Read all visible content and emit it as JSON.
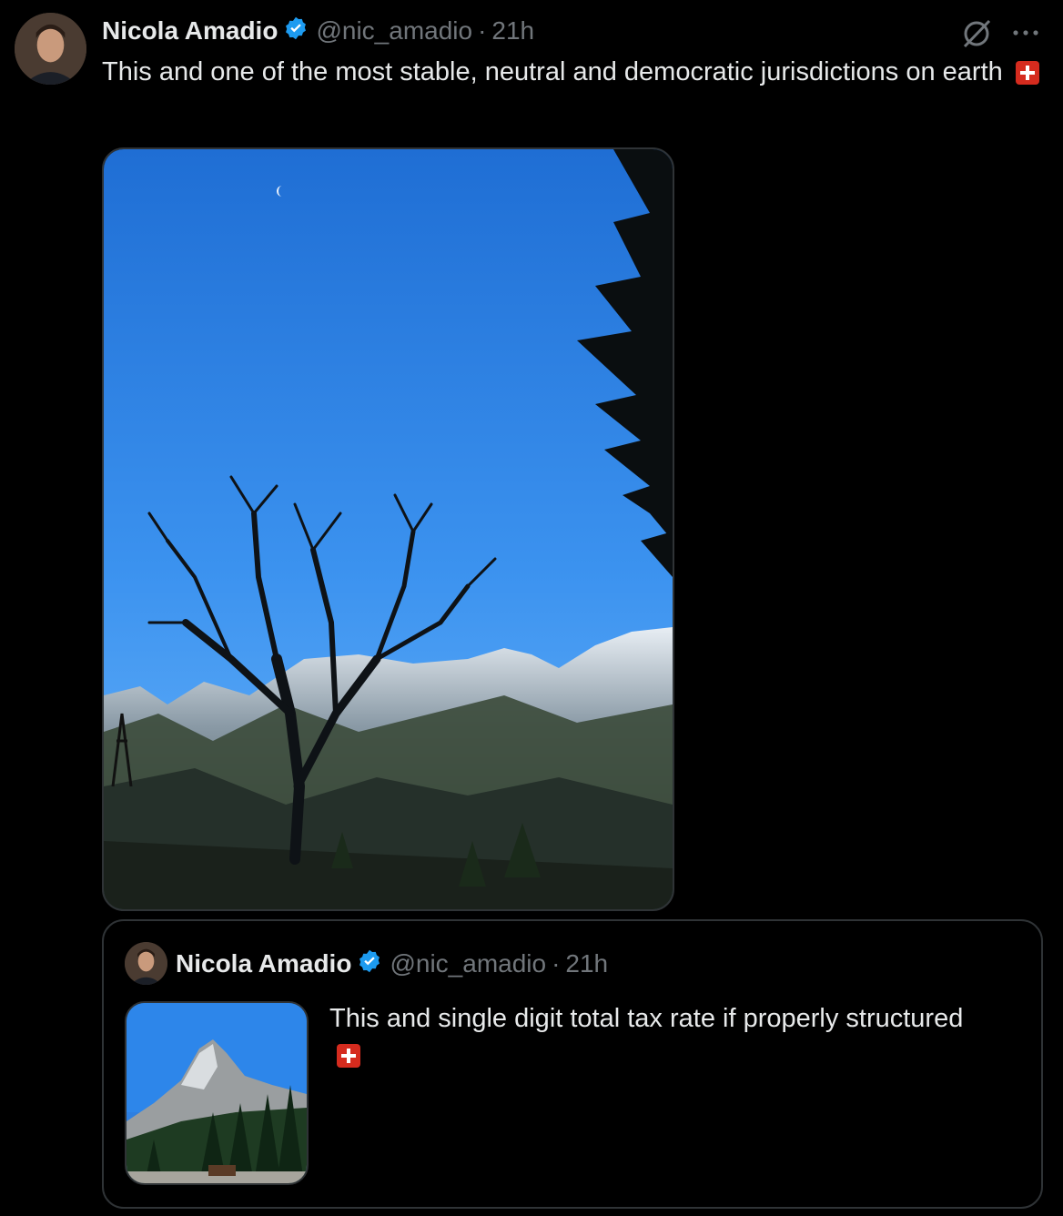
{
  "tweet": {
    "author_name": "Nicola Amadio",
    "handle": "@nic_amadio",
    "separator": "·",
    "time": "21h",
    "text": "This and one of the most stable, neutral and democratic jurisdictions on earth",
    "flag_emoji": "swiss-flag",
    "colors": {
      "verified": "#1d9bf0",
      "muted": "#71767b",
      "text": "#e7e9ea",
      "border": "#2f3336"
    }
  },
  "quote": {
    "author_name": "Nicola Amadio",
    "handle": "@nic_amadio",
    "separator": "·",
    "time": "21h",
    "text": "This and single digit total tax rate if properly structured",
    "flag_emoji": "swiss-flag"
  },
  "actions": {
    "grok_icon": "grok-slash-icon",
    "more_icon": "more-ellipsis-icon"
  }
}
